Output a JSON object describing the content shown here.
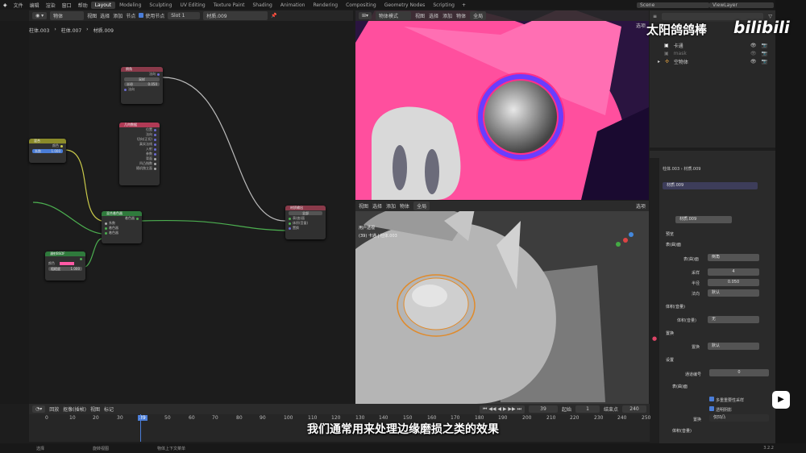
{
  "menu": {
    "items": [
      "文件",
      "编辑",
      "渲染",
      "窗口",
      "帮助"
    ],
    "workspaces": [
      "Layout",
      "Modeling",
      "Sculpting",
      "UV Editing",
      "Texture Paint",
      "Shading",
      "Animation",
      "Rendering",
      "Compositing",
      "Geometry Nodes",
      "Scripting"
    ],
    "active_workspace": "Layout",
    "scene": "Scene",
    "view_layer": "ViewLayer"
  },
  "node_editor": {
    "header": {
      "mode": "物体",
      "menus": [
        "视图",
        "选择",
        "添加",
        "节点"
      ],
      "use_nodes_label": "使用节点",
      "slot": "Slot 1",
      "material": "材质.009"
    },
    "breadcrumb": [
      "柱体.003",
      "柱体.007",
      "材质.009"
    ],
    "nodes": {
      "bevel": {
        "title": "倒角",
        "out": "法向",
        "f1": "采样",
        "f2_label": "半径",
        "f2_value": "0.050",
        "in": "法向"
      },
      "geometry": {
        "title": "几何数据",
        "outputs": [
          "位置",
          "法向",
          "切向(正切)",
          "真实法线",
          "入射",
          "参数",
          "背面",
          "凹凸指数",
          "随机独立面"
        ]
      },
      "value_node": {
        "title": "混合",
        "out": "颜色",
        "f1_label": "系数",
        "f1_value": "1.000"
      },
      "mix": {
        "title": "混合着色器",
        "out": "着色器",
        "inputs": [
          "系数",
          "着色器",
          "着色器"
        ]
      },
      "principled": {
        "title": "漫射BSDF",
        "f1": "颜色",
        "f2_label": "粗糙度",
        "f2_value": "1.000"
      },
      "output": {
        "title": "材质输出",
        "target": "全部",
        "inputs": [
          "表(曲)面",
          "体积(音量)",
          "置换"
        ]
      }
    }
  },
  "viewport_top": {
    "mode": "物体模式",
    "menus": [
      "视图",
      "选择",
      "添加",
      "物体"
    ],
    "transform": "全局",
    "options_label": "选项"
  },
  "viewport_bottom": {
    "menus": [
      "视图",
      "选择",
      "添加",
      "物体"
    ],
    "transform": "全局",
    "label": "用户透视",
    "object_info": "(39) 卡通 | 柱体.003",
    "options_label": "选项"
  },
  "outliner": {
    "items": [
      {
        "name": "卡通",
        "visible": true
      },
      {
        "name": "mask",
        "visible": false
      },
      {
        "name": "空物体",
        "visible": true
      }
    ]
  },
  "properties": {
    "breadcrumb": [
      "柱体.003",
      "材质.009"
    ],
    "slot_name": "材质.009",
    "material_name": "材质.009",
    "sections": {
      "preview": "预览",
      "surface": "表(曲)面",
      "surface_label": "表(曲)面",
      "surface_value": "倒角",
      "samples_label": "采样",
      "samples_value": "4",
      "radius_label": "半径",
      "radius_value": "0.050",
      "normal_label": "法向",
      "normal_value": "默认",
      "volume": "体积(音量)",
      "volume_label": "体积(音量)",
      "volume_value": "无",
      "displacement": "置换",
      "displacement_label": "置换",
      "displacement_value": "默认",
      "settings": "设置",
      "pass_index_label": "通道编号",
      "pass_index_value": "0",
      "surface2": "表(曲)面",
      "multiple_importance": "多重重要性采样",
      "transparent_shadow": "透明阴影",
      "displacement_method_label": "置换",
      "displacement_method_value": "仅凹凸",
      "volume2": "体积(音量)"
    }
  },
  "timeline": {
    "menus": [
      "回放",
      "抠像(插帧)",
      "视图",
      "标记"
    ],
    "current_frame": "39",
    "start_label": "起始",
    "start_value": "1",
    "end_label": "结束点",
    "end_value": "240",
    "ticks": [
      "0",
      "10",
      "20",
      "30",
      "39",
      "50",
      "60",
      "70",
      "80",
      "90",
      "100",
      "110",
      "120",
      "130",
      "140",
      "150",
      "160",
      "170",
      "180",
      "190",
      "200",
      "210",
      "220",
      "230",
      "240",
      "250"
    ]
  },
  "status": {
    "select": "选择",
    "rotate": "旋转视图",
    "context": "物体上下文菜单",
    "version": "3.2.2"
  },
  "overlay": {
    "subtitle": "我们通常用来处理边缘磨损之类的效果",
    "watermark": "太阳鸽鸽棒",
    "bili": "bilibili"
  },
  "colors": {
    "accent": "#4a7dd8",
    "pink": "#ff5aa5",
    "node_geo": "#b03a55",
    "node_shader": "#2f7a3c",
    "node_color": "#c9c94a"
  }
}
